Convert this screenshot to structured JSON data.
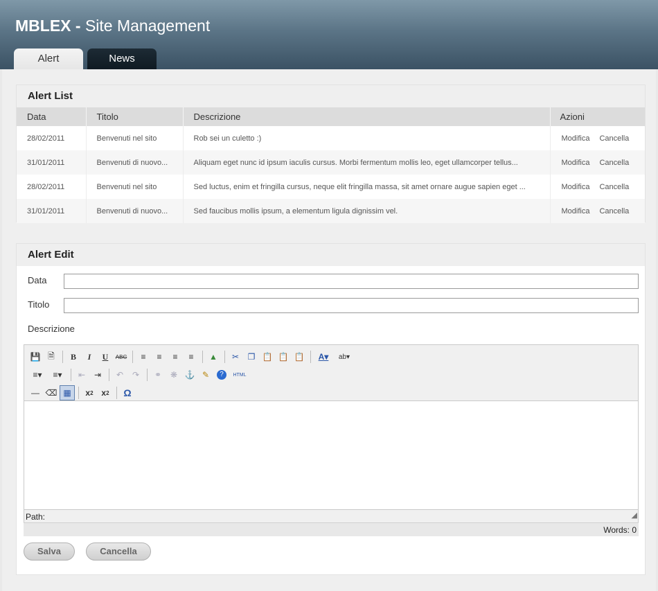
{
  "header": {
    "brand_bold": "MBLEX -",
    "brand_thin": "Site Management"
  },
  "tabs": [
    {
      "label": "Alert",
      "active": true
    },
    {
      "label": "News",
      "active": false
    }
  ],
  "alert_list": {
    "title": "Alert List",
    "columns": [
      "Data",
      "Titolo",
      "Descrizione",
      "Azioni"
    ],
    "rows": [
      {
        "data": "28/02/2011",
        "titolo": "Benvenuti nel sito",
        "descrizione": "Rob sei un culetto :)",
        "modifica": "Modifica",
        "cancella": "Cancella"
      },
      {
        "data": "31/01/2011",
        "titolo": "Benvenuti di nuovo...",
        "descrizione": "Aliquam eget nunc id ipsum iaculis cursus. Morbi fermentum mollis leo, eget ullamcorper tellus...",
        "modifica": "Modifica",
        "cancella": "Cancella"
      },
      {
        "data": "28/02/2011",
        "titolo": "Benvenuti nel sito",
        "descrizione": "Sed luctus, enim et fringilla cursus, neque elit fringilla massa, sit amet ornare augue sapien eget ...",
        "modifica": "Modifica",
        "cancella": "Cancella"
      },
      {
        "data": "31/01/2011",
        "titolo": "Benvenuti di nuovo...",
        "descrizione": "Sed faucibus mollis ipsum, a elementum ligula dignissim vel.",
        "modifica": "Modifica",
        "cancella": "Cancella"
      }
    ]
  },
  "alert_edit": {
    "title": "Alert Edit",
    "data_label": "Data",
    "data_value": "",
    "titolo_label": "Titolo",
    "titolo_value": "",
    "descrizione_label": "Descrizione",
    "path_label": "Path:",
    "word_count": "Words: 0",
    "save_label": "Salva",
    "cancel_label": "Cancella"
  },
  "toolbar_icons": {
    "row1": [
      "save-icon",
      "new-document-icon",
      "bold-icon",
      "italic-icon",
      "underline-icon",
      "strikethrough-icon",
      "align-left-icon",
      "align-center-icon",
      "align-right-icon",
      "align-justify-icon",
      "image-icon",
      "cut-icon",
      "copy-icon",
      "paste-icon",
      "paste-text-icon",
      "paste-word-icon",
      "font-color-icon",
      "highlight-color-icon"
    ],
    "row2": [
      "bullet-list-icon",
      "numbered-list-icon",
      "outdent-icon",
      "indent-icon",
      "undo-icon",
      "redo-icon",
      "link-icon",
      "unlink-icon",
      "anchor-icon",
      "cleanup-icon",
      "help-icon",
      "html-source-icon"
    ],
    "row3": [
      "horizontal-rule-icon",
      "eraser-icon",
      "table-icon",
      "subscript-icon",
      "superscript-icon",
      "special-char-icon"
    ],
    "html_text": "HTML"
  }
}
